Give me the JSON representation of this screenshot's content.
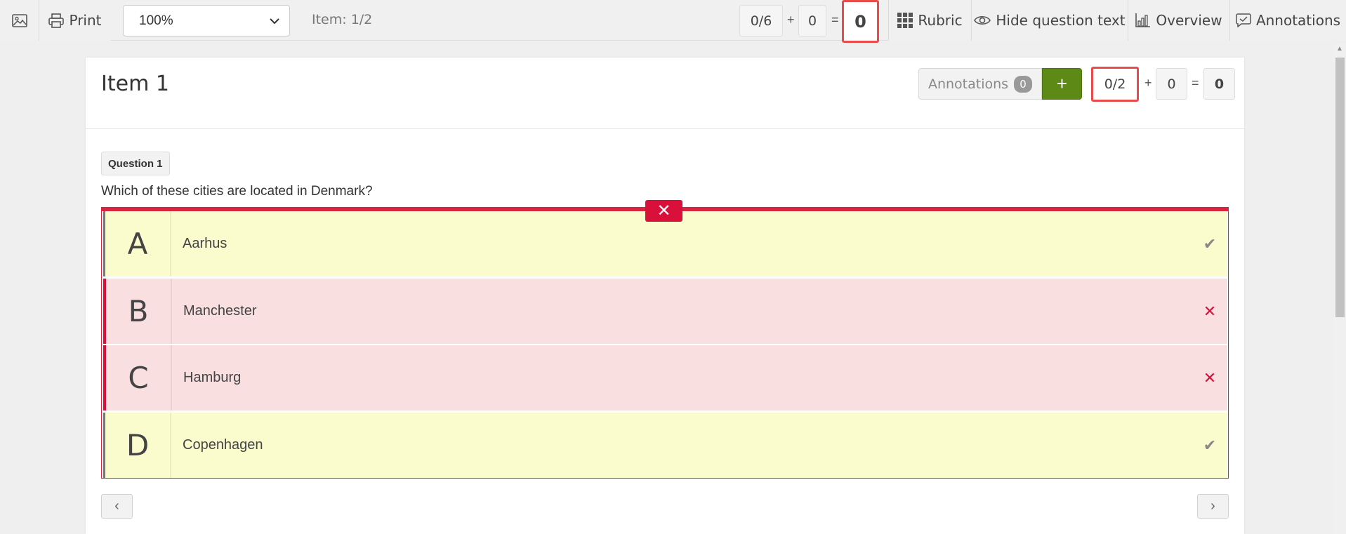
{
  "toolbar": {
    "print_label": "Print",
    "zoom_value": "100%",
    "item_counter": "Item: 1/2",
    "score_total_max": "0/6",
    "score_bonus": "0",
    "score_result": "0",
    "rubric_label": "Rubric",
    "hide_question_label": "Hide question text",
    "overview_label": "Overview",
    "annotations_label": "Annotations",
    "plus_sign": "+",
    "equals_sign": "="
  },
  "item": {
    "title": "Item 1",
    "annotations_label": "Annotations",
    "annotations_count": "0",
    "add_label": "+",
    "score_max": "0/2",
    "score_bonus": "0",
    "score_result": "0"
  },
  "question": {
    "tag": "Question 1",
    "text": "Which of these cities are located in Denmark?",
    "result_badge": "✕",
    "answers": [
      {
        "letter": "A",
        "label": "Aarhus",
        "mark": "✔"
      },
      {
        "letter": "B",
        "label": "Manchester",
        "mark": "✕"
      },
      {
        "letter": "C",
        "label": "Hamburg",
        "mark": "✕"
      },
      {
        "letter": "D",
        "label": "Copenhagen",
        "mark": "✔"
      }
    ]
  },
  "nav": {
    "prev": "‹",
    "next": "›"
  },
  "colors": {
    "accent_red": "#d8103a",
    "add_green": "#5d8a16",
    "correct_bg": "#fafcce",
    "wrong_bg": "#f9dfe0",
    "highlight": "#e94a4a"
  }
}
